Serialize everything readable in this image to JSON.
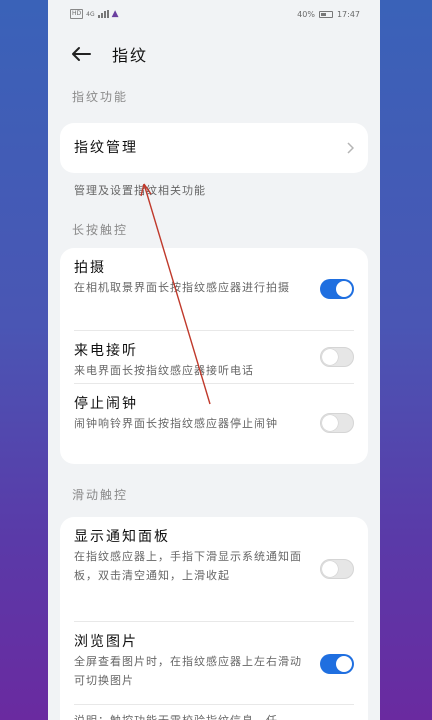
{
  "status_bar": {
    "network_tag": "HD",
    "network_gen": "4G",
    "battery": "40%",
    "time": "17:47"
  },
  "header": {
    "title": "指纹"
  },
  "sections": {
    "fingerprint": {
      "heading": "指纹功能",
      "manage_label": "指纹管理",
      "manage_note": "管理及设置指纹相关功能"
    },
    "long_press": {
      "heading": "长按触控",
      "items": [
        {
          "title": "拍摄",
          "desc": "在相机取景界面长按指纹感应器进行拍摄",
          "enabled": true
        },
        {
          "title": "来电接听",
          "desc": "来电界面长按指纹感应器接听电话",
          "enabled": false
        },
        {
          "title": "停止闹钟",
          "desc": "闹钟响铃界面长按指纹感应器停止闹钟",
          "enabled": false
        }
      ]
    },
    "swipe": {
      "heading": "滑动触控",
      "items": [
        {
          "title": "显示通知面板",
          "desc": "在指纹感应器上，手指下滑显示系统通知面板，双击清空通知，上滑收起",
          "enabled": false
        },
        {
          "title": "浏览图片",
          "desc": "全屏查看图片时，在指纹感应器上左右滑动可切换图片",
          "enabled": true
        }
      ],
      "footer_note": "说明：触控功能无需校验指纹信息，任"
    }
  },
  "colors": {
    "accent": "#1f6fe0",
    "annotation": "#c0392b"
  }
}
